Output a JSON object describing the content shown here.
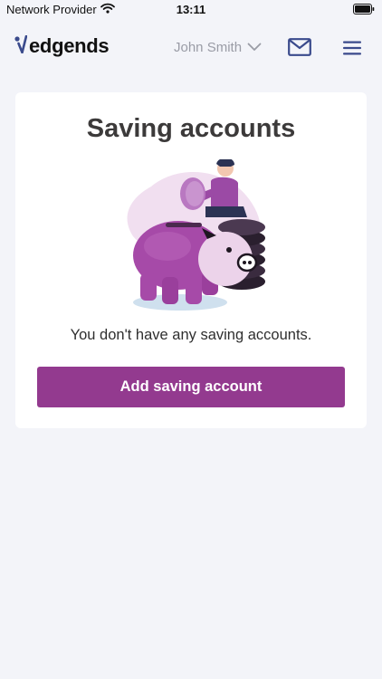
{
  "status_bar": {
    "carrier": "Network Provider",
    "time": "13:11"
  },
  "header": {
    "logo_text": "edgends",
    "user_name": "John Smith"
  },
  "icons": {
    "wifi": "wifi-icon",
    "battery": "battery-icon",
    "logo_mark": "logo-check-icon",
    "user_dropdown": "chevron-down-icon",
    "mail": "mail-icon",
    "menu": "hamburger-menu-icon"
  },
  "main": {
    "title": "Saving accounts",
    "empty_message": "You don't have any saving accounts.",
    "add_button_label": "Add saving account"
  },
  "colors": {
    "accent": "#933a8f",
    "nav_icon": "#3a4a8c",
    "background": "#f3f4f9"
  }
}
